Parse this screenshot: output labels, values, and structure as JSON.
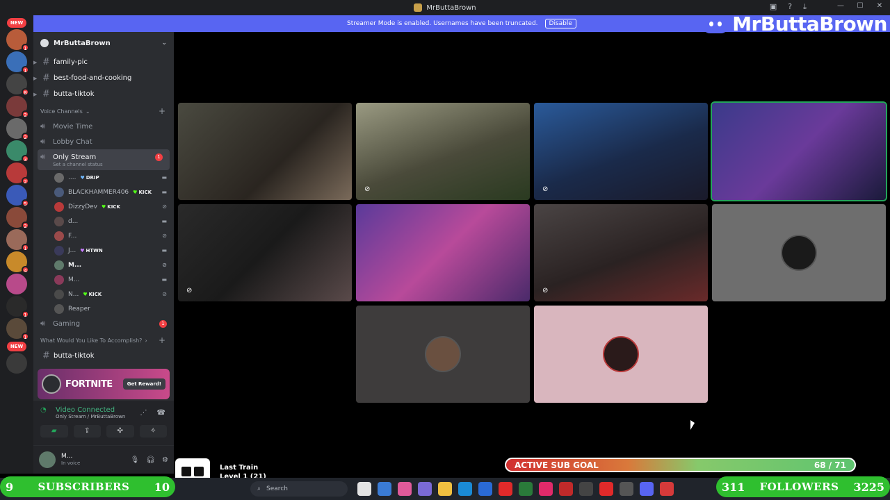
{
  "window": {
    "title": "MrButtaBrown"
  },
  "banner": {
    "text": "Streamer Mode is enabled. Usernames have been truncated.",
    "button": "Disable"
  },
  "overlay": {
    "channel_name": "MrButtaBrown"
  },
  "server_rail": {
    "new_top": "NEW",
    "new_bottom": "NEW",
    "items": [
      {
        "color": "#b85c3a",
        "ping": "1"
      },
      {
        "color": "#3a6fb8",
        "ping": "1"
      },
      {
        "color": "#444444",
        "ping": "8"
      },
      {
        "color": "#7a3a3a",
        "ping": "2"
      },
      {
        "color": "#6a6a6a",
        "ping": "2"
      },
      {
        "color": "#3a8a6a",
        "ping": "3"
      },
      {
        "color": "#b83a3a",
        "ping": "2"
      },
      {
        "color": "#3a5ab8",
        "ping": "5"
      },
      {
        "color": "#8a4a3a",
        "ping": "2"
      },
      {
        "color": "#9a6a5a",
        "ping": "1"
      },
      {
        "color": "#c88a2a",
        "ping": "4"
      },
      {
        "color": "#b84a8a",
        "ping": ""
      },
      {
        "color": "#2a2a2a",
        "ping": "1"
      },
      {
        "color": "#5a4a3a",
        "ping": "1"
      },
      {
        "color": "#3a3a3a",
        "ping": ""
      }
    ]
  },
  "sidebar": {
    "guild_name": "MrButtaBrown",
    "text_channels": [
      "family-pic",
      "best-food-and-cooking",
      "butta-tiktok"
    ],
    "voice_category": "Voice Channels",
    "voice_channels": [
      {
        "name": "Movie Time"
      },
      {
        "name": "Lobby Chat"
      }
    ],
    "active_channel": {
      "name": "Only Stream",
      "status": "Set a channel status",
      "badge": "1"
    },
    "voice_users": [
      {
        "name": "....",
        "tag": "DRIP",
        "tag_color": "blue",
        "av": "#6a6a6a"
      },
      {
        "name": "BLACKHAMMER406",
        "tag": "KICK",
        "tag_color": "green",
        "av": "#4a5a7a"
      },
      {
        "name": "DizzyDev",
        "tag": "KICK",
        "tag_color": "green",
        "av": "#b83a3a"
      },
      {
        "name": "d...",
        "tag": "",
        "tag_color": "",
        "av": "#5a4a4a"
      },
      {
        "name": "F...",
        "tag": "",
        "tag_color": "",
        "av": "#9a4a4a"
      },
      {
        "name": "J...",
        "tag": "HTWN",
        "tag_color": "pink",
        "av": "#3a3a5a"
      },
      {
        "name": "M...",
        "tag": "",
        "tag_color": "",
        "av": "#5f7a6b"
      },
      {
        "name": "M...",
        "tag": "",
        "tag_color": "",
        "av": "#8a3a5a"
      },
      {
        "name": "N...",
        "tag": "KICK",
        "tag_color": "green",
        "av": "#4a4a4a"
      },
      {
        "name": "Reaper",
        "tag": "",
        "tag_color": "",
        "av": "#555555"
      }
    ],
    "more_channels": [
      {
        "name": "Gaming",
        "badge": "1"
      }
    ],
    "accomplish_category": "What Would You Like To Accomplish?",
    "last_text_channel": "butta-tiktok"
  },
  "promo": {
    "title": "FORTNITE",
    "button": "Get Reward!"
  },
  "rtc": {
    "status": "Video Connected",
    "location": "Only Stream / MrButtaBrown"
  },
  "user": {
    "name": "M...",
    "status": "In voice"
  },
  "tiles": [
    {
      "bg": "linear-gradient(135deg,#4a4a40,#2a2520 60%,#7a6a5a)"
    },
    {
      "bg": "linear-gradient(160deg,#9a9a82,#4a4a3a 55%,#2a3a20)"
    },
    {
      "bg": "linear-gradient(160deg,#2a5a9a,#1a2a4a 55%,#1a1a2a)"
    },
    {
      "bg": "linear-gradient(135deg,#3a3a8a,#6a3a9a 50%,#1a1a3a)"
    },
    {
      "bg": "linear-gradient(135deg,#2a2a2a,#1a1a1a 50%,#5a4a4a)"
    },
    {
      "bg": "linear-gradient(135deg,#5a3a9a,#b84a9a 50%,#4a2a6a)"
    },
    {
      "bg": "linear-gradient(160deg,#4a4444,#2a2222 55%,#6a2a2a)"
    },
    {
      "bg": "#6e6e6e"
    },
    {
      "bg": "#3e3c3c"
    },
    {
      "bg": "#d9b6be"
    }
  ],
  "now_playing": {
    "line1": "Last Train",
    "line2": "Level 1  (21)"
  },
  "sub_goal": {
    "label": "ACTIVE SUB GOAL",
    "current": 68,
    "target": 71,
    "count_text": "68 / 71"
  },
  "subscribers": {
    "left_value": "9",
    "label": "SUBSCRIBERS",
    "right_value": "10"
  },
  "followers": {
    "left_value": "311",
    "label": "FOLLOWERS",
    "right_value": "3225"
  },
  "taskbar": {
    "search_placeholder": "Search",
    "icons": [
      "#e3e3e3",
      "#3a7bd5",
      "#e05a9a",
      "#7a6ad5",
      "#f0c040",
      "#1a8ad5",
      "#2a6ad5",
      "#e02a2a",
      "#2a7a3a",
      "#e02a6a",
      "#c02a2a",
      "#444444",
      "#e02a2a",
      "#555555",
      "#5865f2",
      "#d53a3a"
    ]
  }
}
